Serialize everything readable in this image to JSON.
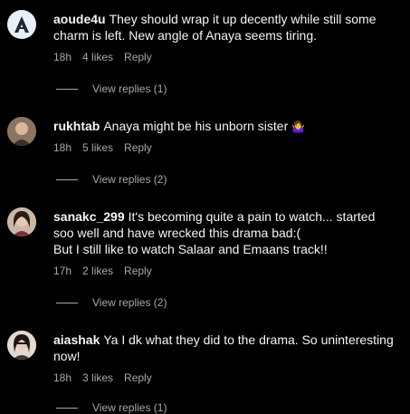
{
  "comments": [
    {
      "username": "aoude4u",
      "text": "They should wrap it up decently while still some charm is left. New angle of Anaya seems tiring.",
      "time": "18h",
      "likes": "4 likes",
      "reply": "Reply",
      "view_replies": "View replies (1)"
    },
    {
      "username": "rukhtab",
      "text": "Anaya might be his unborn sister",
      "emoji": "🤷‍♀️",
      "time": "18h",
      "likes": "5 likes",
      "reply": "Reply",
      "view_replies": "View replies (2)"
    },
    {
      "username": "sanakc_299",
      "text": "It's becoming quite a pain to watch... started soo well and have wrecked this drama bad:(",
      "text2": "But I still like to watch Salaar and Emaans track!!",
      "time": "17h",
      "likes": "2 likes",
      "reply": "Reply",
      "view_replies": "View replies (2)"
    },
    {
      "username": "aiashak",
      "text": "Ya I dk what they did to the drama. So uninteresting now!",
      "time": "18h",
      "likes": "3 likes",
      "reply": "Reply",
      "view_replies": "View replies (1)"
    }
  ],
  "colors": {
    "background": "#000000",
    "primary_text": "#f5f5f5",
    "secondary_text": "#a8a8a8"
  },
  "icons": [
    "logo-avatar",
    "profile-photo",
    "profile-photo",
    "profile-photo"
  ]
}
